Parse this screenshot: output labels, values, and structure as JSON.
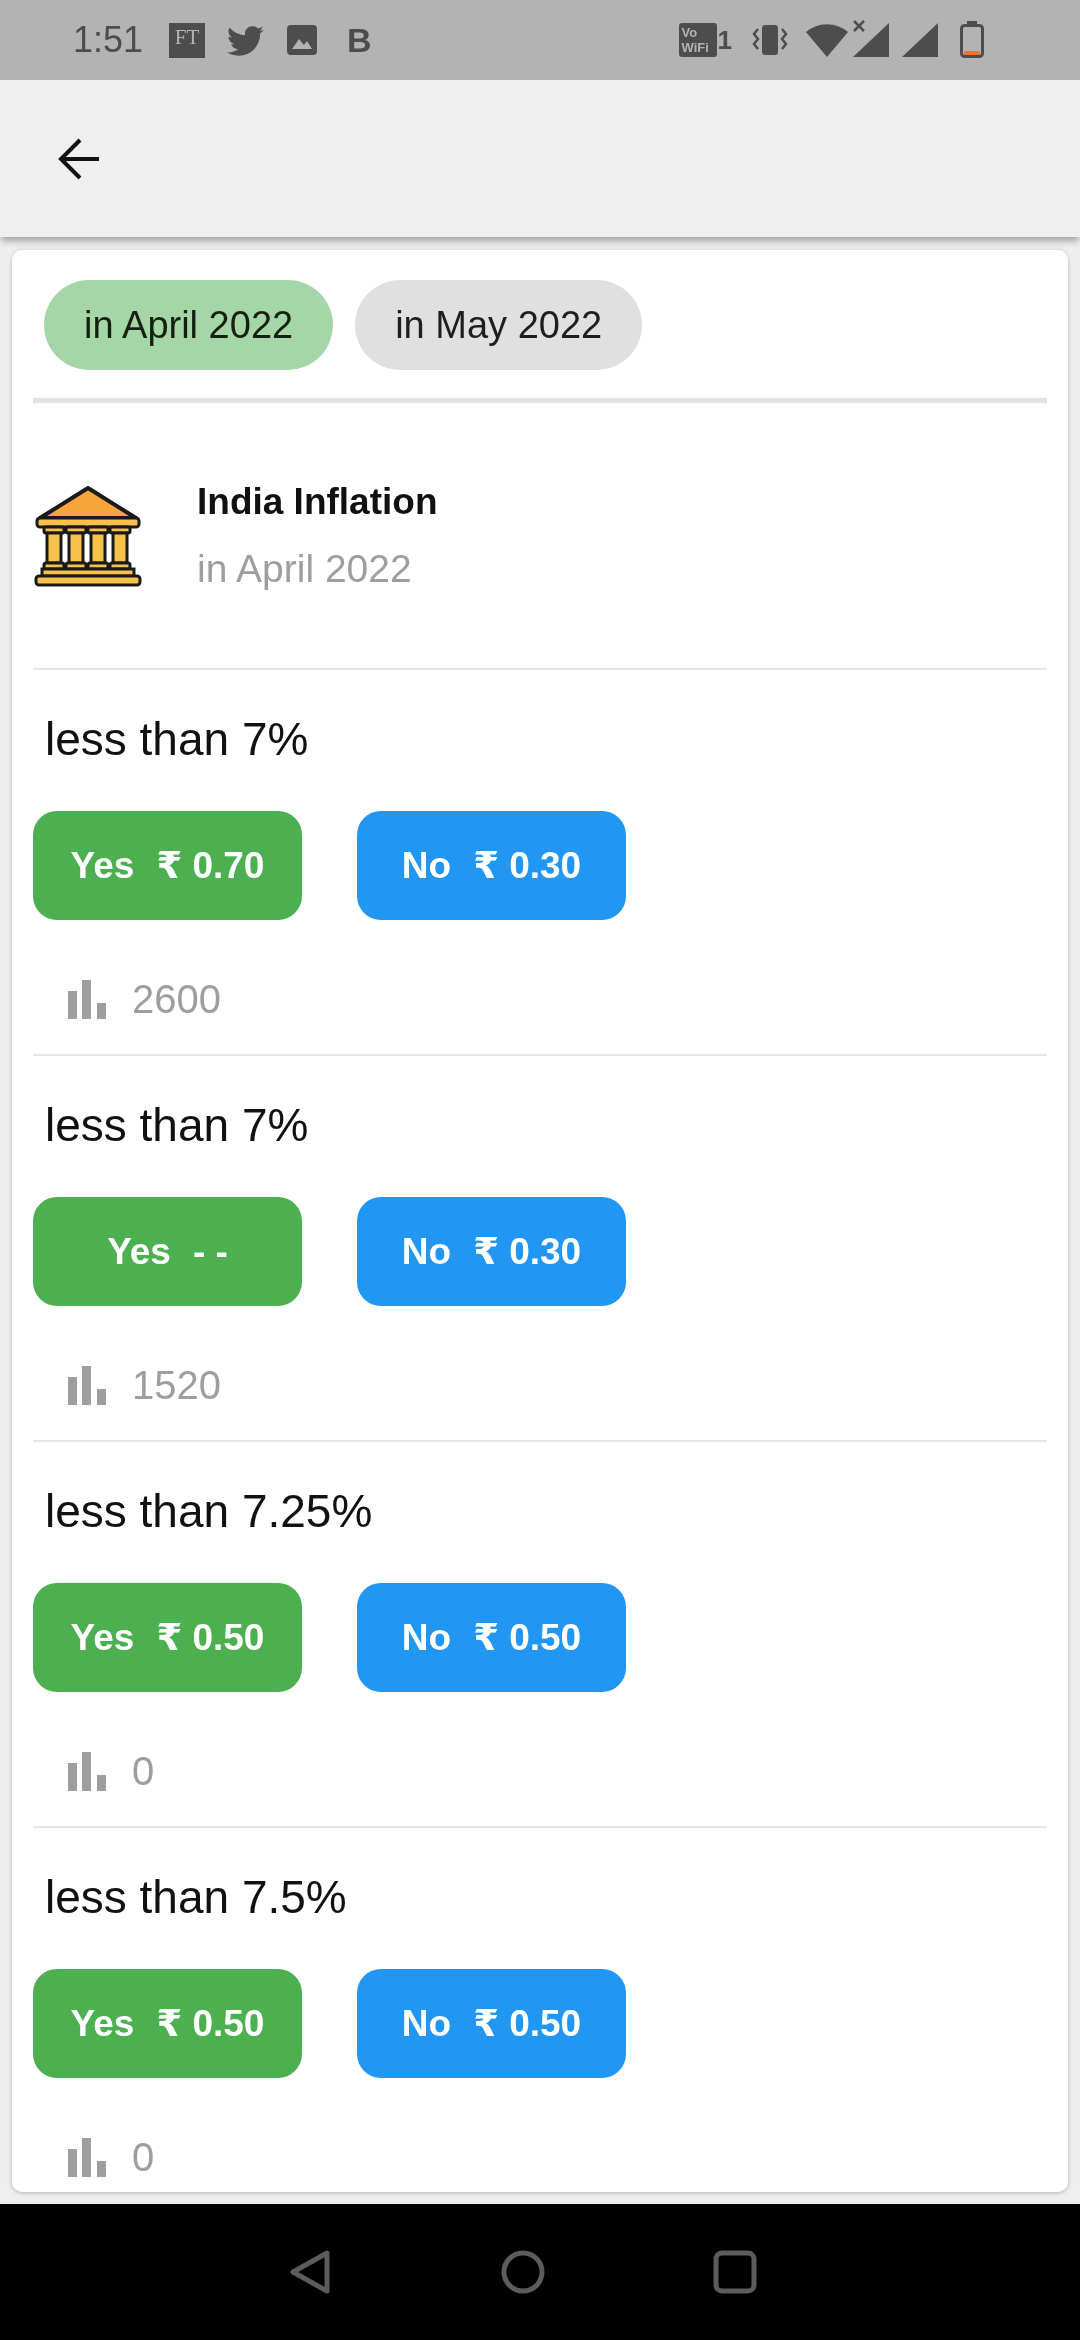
{
  "status_bar": {
    "time": "1:51",
    "notification_icons": [
      {
        "kind": "ft",
        "text": "FT"
      },
      {
        "kind": "bird"
      },
      {
        "kind": "picture"
      },
      {
        "kind": "letter",
        "text": "B"
      }
    ],
    "vowifi": {
      "text": "Vo WiFi",
      "slot": "1"
    }
  },
  "filters": [
    {
      "label": "in April 2022",
      "selected": true
    },
    {
      "label": "in May 2022",
      "selected": false
    }
  ],
  "event": {
    "title": "India Inflation",
    "subtitle": "in April 2022"
  },
  "questions": [
    {
      "title": "less than 7%",
      "options": [
        {
          "kind": "yes",
          "label": "Yes",
          "price": "₹ 0.70"
        },
        {
          "kind": "no",
          "label": "No",
          "price": "₹ 0.30"
        }
      ],
      "count": "2600"
    },
    {
      "title": "less than 7%",
      "options": [
        {
          "kind": "yes",
          "label": "Yes",
          "price": "- -"
        },
        {
          "kind": "no",
          "label": "No",
          "price": "₹ 0.30"
        }
      ],
      "count": "1520"
    },
    {
      "title": "less than 7.25%",
      "options": [
        {
          "kind": "yes",
          "label": "Yes",
          "price": "₹ 0.50"
        },
        {
          "kind": "no",
          "label": "No",
          "price": "₹ 0.50"
        }
      ],
      "count": "0"
    },
    {
      "title": "less than 7.5%",
      "options": [
        {
          "kind": "yes",
          "label": "Yes",
          "price": "₹ 0.50"
        },
        {
          "kind": "no",
          "label": "No",
          "price": "₹ 0.50"
        }
      ],
      "count": "0"
    }
  ]
}
